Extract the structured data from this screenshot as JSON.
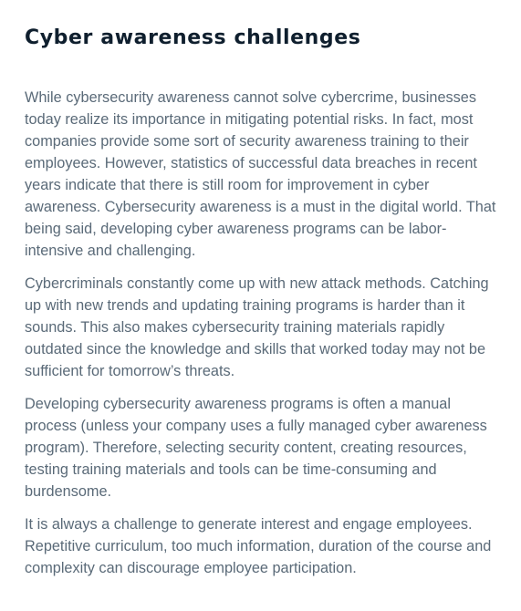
{
  "article": {
    "title": "Cyber awareness challenges",
    "paragraphs": [
      "While cybersecurity awareness cannot solve cybercrime, businesses today realize its importance in mitigating potential risks. In fact, most companies provide some sort of security awareness training to their employees. However, statistics of successful data breaches in recent years indicate that there is still room for improvement in cyber awareness. Cybersecurity awareness is a must in the digital world. That being said, developing cyber awareness programs can be labor-intensive and challenging.",
      "Cybercriminals constantly come up with new attack methods. Catching up with new trends and updating training programs is harder than it sounds. This also makes cybersecurity training materials rapidly outdated since the knowledge and skills that worked today may not be sufficient for tomorrow’s threats.",
      "Developing cybersecurity awareness programs is often a manual process (unless your company uses a fully managed cyber awareness program). Therefore, selecting security content, creating resources, testing training materials and tools can be time-consuming and burdensome.",
      "It is always a challenge to generate interest and engage employees. Repetitive curriculum, too much information, duration of the course and complexity can discourage employee participation."
    ]
  }
}
